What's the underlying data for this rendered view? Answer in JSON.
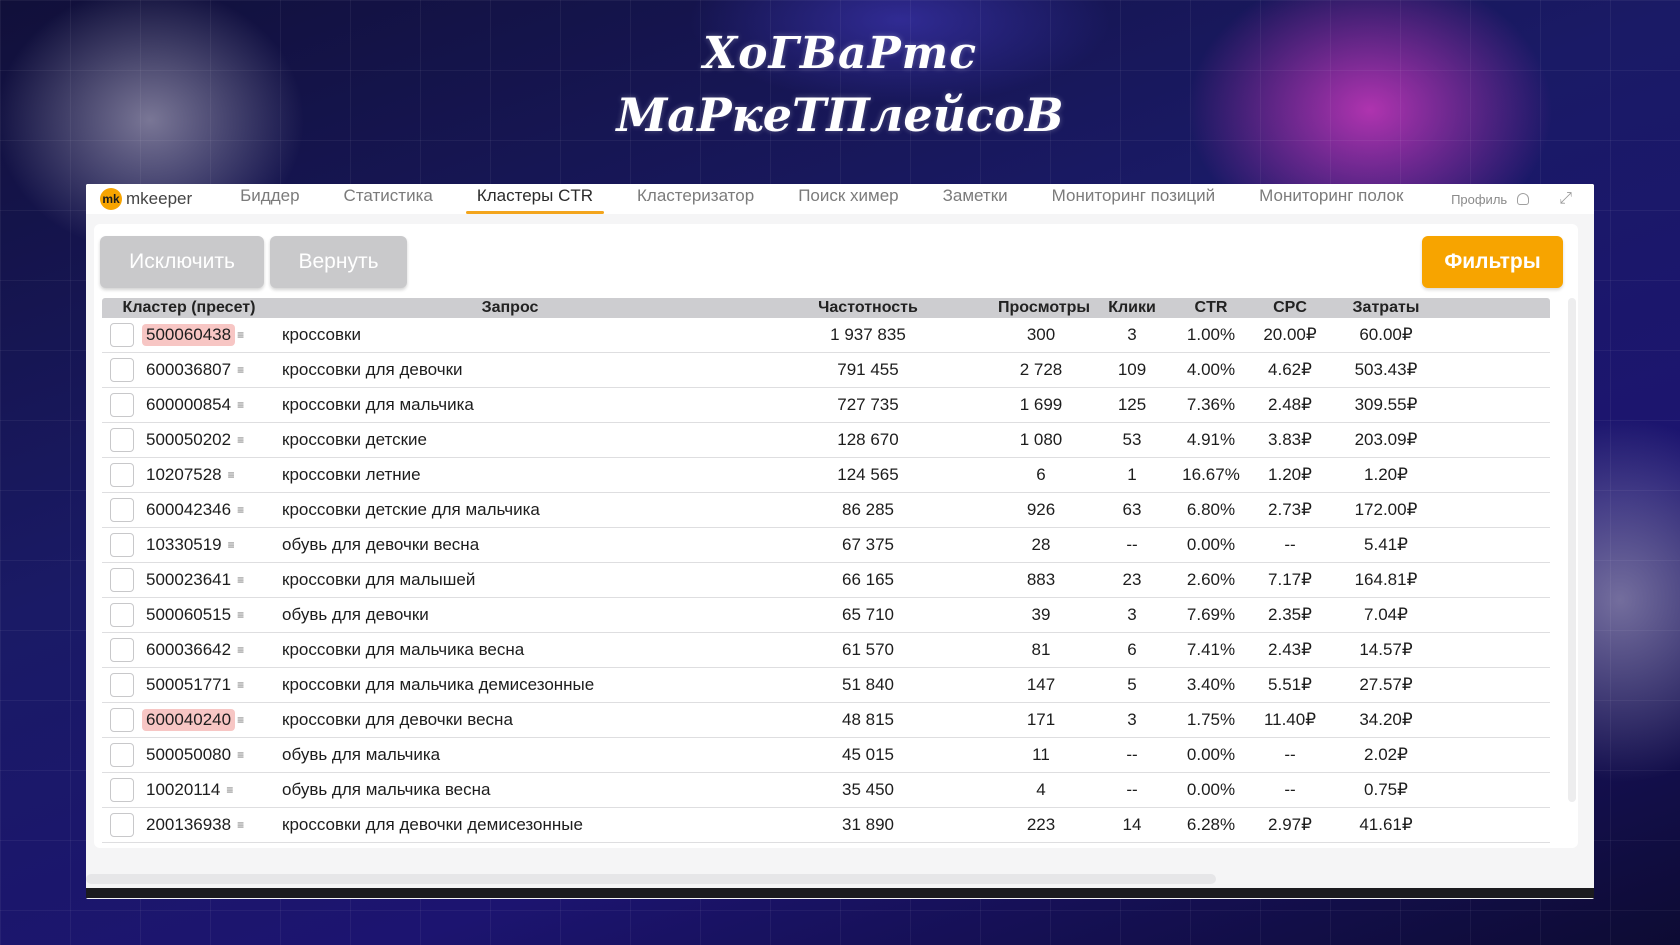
{
  "overlay": {
    "line1": "ХоГВаРтс",
    "line2": "МаРкеТПлейсоВ"
  },
  "nav": {
    "brand_mark": "mk",
    "brand_name": "mkeeper",
    "tabs": [
      {
        "label": "Биддер"
      },
      {
        "label": "Статистика"
      },
      {
        "label": "Кластеры CTR",
        "active": true
      },
      {
        "label": "Кластеризатор"
      },
      {
        "label": "Поиск химер"
      },
      {
        "label": "Заметки"
      },
      {
        "label": "Мониторинг позиций"
      },
      {
        "label": "Мониторинг полок"
      }
    ],
    "profile_label": "Профиль"
  },
  "toolbar": {
    "exclude_label": "Исключить",
    "return_label": "Вернуть",
    "filters_label": "Фильтры"
  },
  "colors": {
    "accent": "#f7a400",
    "highlight": "#f7c6c4"
  },
  "table": {
    "headers": {
      "cluster": "Кластер (пресет)",
      "query": "Запрос",
      "frequency": "Частотность",
      "views": "Просмотры",
      "clicks": "Клики",
      "ctr": "CTR",
      "cpc": "CPC",
      "cost": "Затраты"
    },
    "rows": [
      {
        "cluster": "500060438",
        "hl": true,
        "query": "кроссовки",
        "frequency": "1 937 835",
        "views": "300",
        "clicks": "3",
        "ctr": "1.00%",
        "cpc": "20.00₽",
        "cost": "60.00₽"
      },
      {
        "cluster": "600036807",
        "hl": false,
        "query": "кроссовки для девочки",
        "frequency": "791 455",
        "views": "2 728",
        "clicks": "109",
        "ctr": "4.00%",
        "cpc": "4.62₽",
        "cost": "503.43₽"
      },
      {
        "cluster": "600000854",
        "hl": false,
        "query": "кроссовки для мальчика",
        "frequency": "727 735",
        "views": "1 699",
        "clicks": "125",
        "ctr": "7.36%",
        "cpc": "2.48₽",
        "cost": "309.55₽"
      },
      {
        "cluster": "500050202",
        "hl": false,
        "query": "кроссовки детские",
        "frequency": "128 670",
        "views": "1 080",
        "clicks": "53",
        "ctr": "4.91%",
        "cpc": "3.83₽",
        "cost": "203.09₽"
      },
      {
        "cluster": "10207528",
        "hl": false,
        "query": "кроссовки летние",
        "frequency": "124 565",
        "views": "6",
        "clicks": "1",
        "ctr": "16.67%",
        "cpc": "1.20₽",
        "cost": "1.20₽"
      },
      {
        "cluster": "600042346",
        "hl": false,
        "query": "кроссовки детские для мальчика",
        "frequency": "86 285",
        "views": "926",
        "clicks": "63",
        "ctr": "6.80%",
        "cpc": "2.73₽",
        "cost": "172.00₽"
      },
      {
        "cluster": "10330519",
        "hl": false,
        "query": "обувь для девочки весна",
        "frequency": "67 375",
        "views": "28",
        "clicks": "--",
        "ctr": "0.00%",
        "cpc": "--",
        "cost": "5.41₽"
      },
      {
        "cluster": "500023641",
        "hl": false,
        "query": "кроссовки для малышей",
        "frequency": "66 165",
        "views": "883",
        "clicks": "23",
        "ctr": "2.60%",
        "cpc": "7.17₽",
        "cost": "164.81₽"
      },
      {
        "cluster": "500060515",
        "hl": false,
        "query": "обувь для девочки",
        "frequency": "65 710",
        "views": "39",
        "clicks": "3",
        "ctr": "7.69%",
        "cpc": "2.35₽",
        "cost": "7.04₽"
      },
      {
        "cluster": "600036642",
        "hl": false,
        "query": "кроссовки для мальчика весна",
        "frequency": "61 570",
        "views": "81",
        "clicks": "6",
        "ctr": "7.41%",
        "cpc": "2.43₽",
        "cost": "14.57₽"
      },
      {
        "cluster": "500051771",
        "hl": false,
        "query": "кроссовки для мальчика демисезонные",
        "frequency": "51 840",
        "views": "147",
        "clicks": "5",
        "ctr": "3.40%",
        "cpc": "5.51₽",
        "cost": "27.57₽"
      },
      {
        "cluster": "600040240",
        "hl": true,
        "query": "кроссовки для девочки весна",
        "frequency": "48 815",
        "views": "171",
        "clicks": "3",
        "ctr": "1.75%",
        "cpc": "11.40₽",
        "cost": "34.20₽"
      },
      {
        "cluster": "500050080",
        "hl": false,
        "query": "обувь для мальчика",
        "frequency": "45 015",
        "views": "11",
        "clicks": "--",
        "ctr": "0.00%",
        "cpc": "--",
        "cost": "2.02₽"
      },
      {
        "cluster": "10020114",
        "hl": false,
        "query": "обувь для мальчика весна",
        "frequency": "35 450",
        "views": "4",
        "clicks": "--",
        "ctr": "0.00%",
        "cpc": "--",
        "cost": "0.75₽"
      },
      {
        "cluster": "200136938",
        "hl": false,
        "query": "кроссовки для девочки демисезонные",
        "frequency": "31 890",
        "views": "223",
        "clicks": "14",
        "ctr": "6.28%",
        "cpc": "2.97₽",
        "cost": "41.61₽"
      }
    ]
  }
}
